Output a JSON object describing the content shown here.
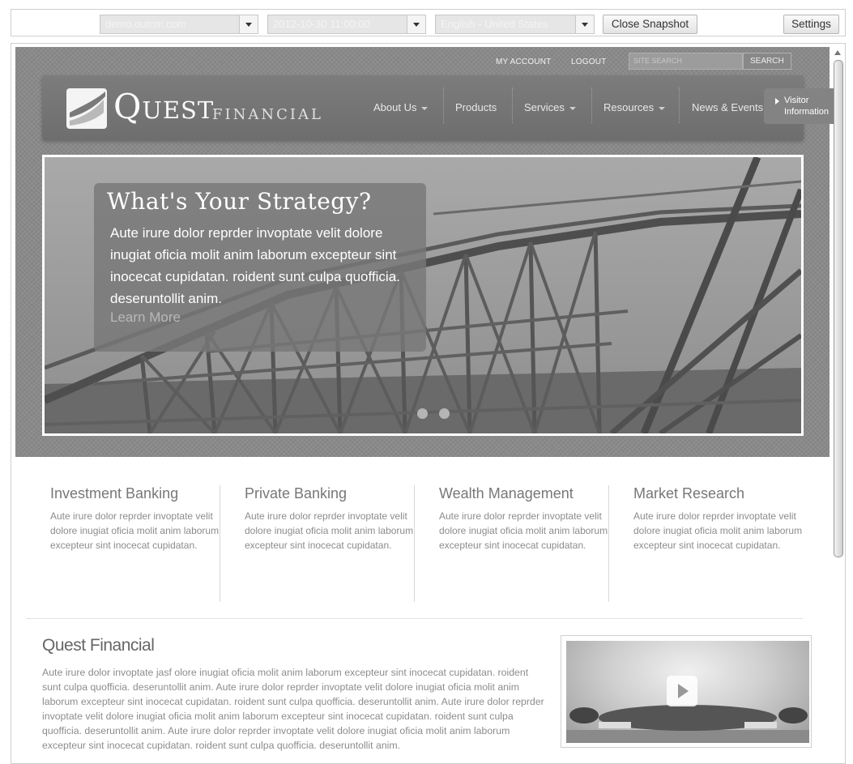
{
  "toolbar": {
    "domain_select": "demo.outcm.com",
    "date_select": "2012-10-30 11:00:00",
    "language_select": "English - United States",
    "close_snapshot_label": "Close Snapshot",
    "settings_label": "Settings"
  },
  "site": {
    "util": {
      "my_account": "MY ACCOUNT",
      "logout": "LOGOUT",
      "search_placeholder": "SITE SEARCH",
      "search_button": "SEARCH"
    },
    "logo": {
      "quest": "Quest",
      "financial": "FINANCIAL"
    },
    "nav": [
      {
        "label": "About Us",
        "has_menu": true
      },
      {
        "label": "Products",
        "has_menu": false
      },
      {
        "label": "Services",
        "has_menu": true
      },
      {
        "label": "Resources",
        "has_menu": true
      },
      {
        "label": "News & Events",
        "has_menu": false
      }
    ],
    "visitor_tab": {
      "line1": "Visitor",
      "line2": "Information"
    },
    "hero": {
      "title": "What's Your Strategy?",
      "text": "Aute irure dolor reprder invoptate velit dolore inugiat oficia molit anim laborum excepteur sint inocecat cupidatan. roident sunt culpa quofficia. deseruntollit anim.",
      "link": "Learn More"
    },
    "services": [
      {
        "title": "Investment Banking",
        "text": "Aute irure dolor reprder invoptate velit dolore inugiat oficia molit anim laborum excepteur sint inocecat cupidatan."
      },
      {
        "title": "Private Banking",
        "text": "Aute irure dolor reprder invoptate velit dolore inugiat oficia molit anim laborum excepteur sint inocecat cupidatan."
      },
      {
        "title": "Wealth Management",
        "text": "Aute irure dolor reprder invoptate velit dolore inugiat oficia molit anim laborum excepteur sint inocecat cupidatan."
      },
      {
        "title": "Market Research",
        "text": "Aute irure dolor reprder invoptate velit dolore inugiat oficia molit anim laborum excepteur sint inocecat cupidatan."
      }
    ],
    "about": {
      "title": "Quest Financial",
      "text": "Aute irure dolor invoptate jasf olore inugiat oficia molit anim laborum excepteur sint inocecat cupidatan. roident sunt culpa quofficia. deseruntollit anim. Aute irure dolor reprder invoptate velit dolore inugiat oficia molit anim laborum excepteur sint inocecat cupidatan. roident sunt culpa quofficia. deseruntollit anim. Aute irure dolor reprder invoptate velit dolore inugiat oficia molit anim laborum excepteur sint inocecat cupidatan. roident sunt culpa quofficia. deseruntollit anim. Aute irure dolor reprder invoptate velit dolore inugiat oficia molit anim laborum excepteur sint inocecat cupidatan. roident sunt culpa quofficia. deseruntollit anim."
    }
  },
  "icons": [
    "chevron-down-icon",
    "triangle-right-icon",
    "play-icon",
    "scroll-up-icon"
  ],
  "colors": {
    "header_bg": "#8a8a8a",
    "nav_bg": "#747474",
    "text": "#8c8c8c"
  }
}
